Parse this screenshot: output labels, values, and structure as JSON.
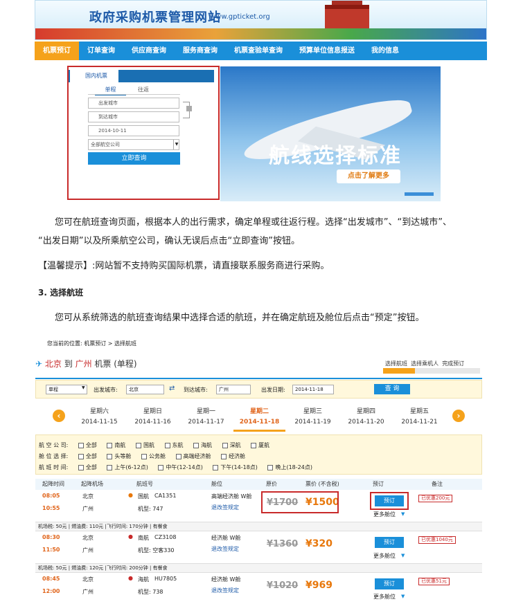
{
  "banner": {
    "title": "政府采购机票管理网站",
    "url": "www.gpticket.org"
  },
  "nav": [
    "机票预订",
    "订单查询",
    "供应商查询",
    "服务商查询",
    "机票查验单查询",
    "预算单位信息报送",
    "我的信息"
  ],
  "search_box": {
    "tab": "国内机票",
    "trip_types": [
      "单程",
      "往返"
    ],
    "from_placeholder": "出发城市",
    "to_placeholder": "到达城市",
    "date": "2014-10-11",
    "airline": "全部航空公司",
    "button": "立即查询"
  },
  "promo": {
    "slogan": "航线选择标准",
    "more": "点击了解更多"
  },
  "text": {
    "para1": "您可在航班查询页面，根据本人的出行需求，确定单程或往返行程。选择“出发城市”、“到达城市”、",
    "para1b": "“出发日期”以及所乘航空公司，确认无误后点击“立即查询”按钮。",
    "tip": "【温馨提示】:网站暂不支持购买国际机票，请直接联系服务商进行采购。",
    "heading": "3. 选择航班",
    "para2": "您可从系统筛选的航班查询结果中选择合适的航班，并在确定航班及舱位后点击“预定”按钮。"
  },
  "breadcrumb": "您当前的位置: 机票预订 > 选择航班",
  "route": {
    "from": "北京",
    "to_word": "到",
    "dest": "广州",
    "suffix": "机票 (单程)"
  },
  "steps": [
    "选择航班",
    "选择乘机人",
    "完成预订"
  ],
  "query": {
    "type": "单程",
    "from_label": "出发城市:",
    "from": "北京",
    "to_label": "到达城市:",
    "to": "广州",
    "date_label": "出发日期:",
    "date": "2014-11-18",
    "button": "查 询"
  },
  "days": [
    {
      "w": "星期六",
      "d": "2014-11-15"
    },
    {
      "w": "星期日",
      "d": "2014-11-16"
    },
    {
      "w": "星期一",
      "d": "2014-11-17"
    },
    {
      "w": "星期二",
      "d": "2014-11-18"
    },
    {
      "w": "星期三",
      "d": "2014-11-19"
    },
    {
      "w": "星期四",
      "d": "2014-11-20"
    },
    {
      "w": "星期五",
      "d": "2014-11-21"
    }
  ],
  "filters": {
    "airline_label": "航 空 公 司:",
    "airlines": [
      "全部",
      "南航",
      "国航",
      "东航",
      "海航",
      "深航",
      "厦航"
    ],
    "cabin_label": "舱 位 选 择:",
    "cabins": [
      "全部",
      "头等舱",
      "公务舱",
      "高端经济舱",
      "经济舱"
    ],
    "time_label": "航 班 时 间:",
    "times": [
      "全部",
      "上午(6-12点)",
      "中午(12-14点)",
      "下午(14-18点)",
      "晚上(18-24点)"
    ]
  },
  "table_headers": [
    "起降时间",
    "起降机场",
    "航班号",
    "舱位",
    "原价",
    "票价 (不含税)",
    "预订",
    "备注"
  ],
  "flights": [
    {
      "dep": "08:05",
      "arr": "10:55",
      "from": "北京",
      "to": "广州",
      "airline": "国航",
      "no": "CA1351",
      "model": "机型: 747",
      "cabin": "高端经济舱 W舱",
      "rule": "退改签规定",
      "orig": "¥1700",
      "price": "¥1500",
      "book": "预订",
      "more": "更多舱位",
      "disc": "已优惠200元",
      "tax": "机场税: 50元 | 燃油费: 110元 |飞行时间: 170分钟 | 有餐食"
    },
    {
      "dep": "08:30",
      "arr": "11:50",
      "from": "北京",
      "to": "广州",
      "airline": "南航",
      "no": "CZ3108",
      "model": "机型: 空客330",
      "cabin": "经济舱 W舱",
      "rule": "退改签规定",
      "orig": "¥1360",
      "price": "¥320",
      "book": "预订",
      "more": "更多舱位",
      "disc": "已优惠1040元",
      "tax": "机场税: 50元 | 燃油费: 120元 |飞行时间: 200分钟 | 有餐食"
    },
    {
      "dep": "08:45",
      "arr": "12:00",
      "from": "北京",
      "to": "广州",
      "airline": "海航",
      "no": "HU7805",
      "model": "机型: 738",
      "cabin": "经济舱 W舱",
      "rule": "退改签规定",
      "orig": "¥1020",
      "price": "¥969",
      "book": "预订",
      "more": "更多舱位",
      "disc": "已优惠51元",
      "tax": ""
    }
  ]
}
